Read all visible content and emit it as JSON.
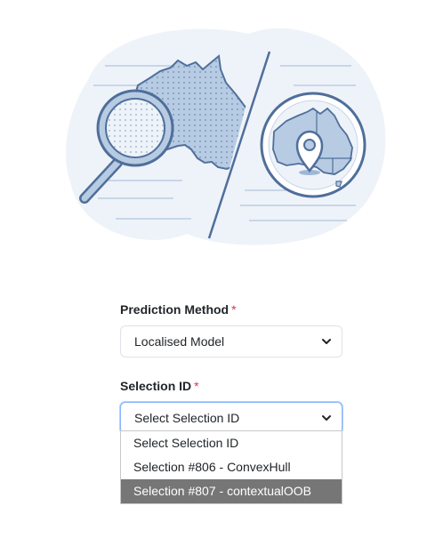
{
  "illustration": {
    "left_icon": "magnifier-over-australia-map",
    "right_icon": "australia-map-with-location-pin",
    "colors": {
      "outline": "#4f6f9a",
      "fill": "#b7cbe3",
      "background": "#eef3f9"
    }
  },
  "form": {
    "prediction_method": {
      "label": "Prediction Method",
      "required_mark": "*",
      "value": "Localised Model"
    },
    "selection_id": {
      "label": "Selection ID",
      "required_mark": "*",
      "value": "Select Selection ID",
      "options": [
        "Select Selection ID",
        "Selection #806 - ConvexHull",
        "Selection #807 - contextualOOB"
      ],
      "highlighted_index": 2
    }
  },
  "colors": {
    "required": "#dc3545",
    "highlight": "#767676",
    "focus_border": "#86b7fe"
  }
}
